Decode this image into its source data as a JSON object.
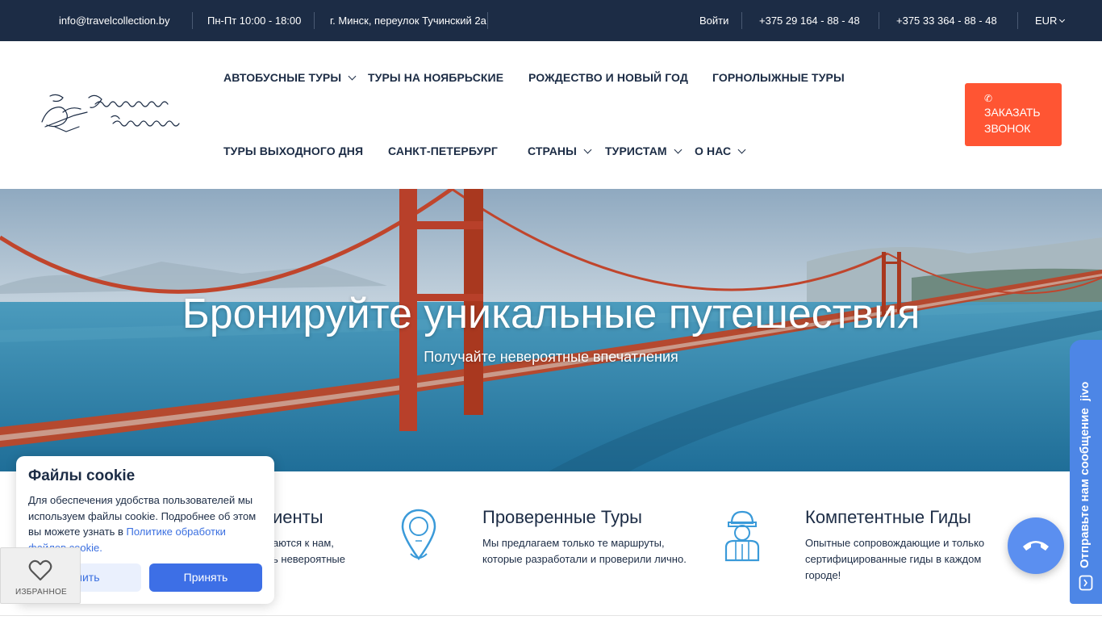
{
  "topbar": {
    "email": "info@travelcollection.by",
    "hours": "Пн-Пт 10:00 - 18:00",
    "address": "г. Минск, переулок Тучинский 2а",
    "login": "Войти",
    "phone1": "+375 29 164 - 88 - 48",
    "phone2": "+375 33 364 - 88 - 48",
    "currency": "EUR"
  },
  "nav": {
    "bus_tours": "АВТОБУСНЫЕ ТУРЫ",
    "november_tours": "ТУРЫ НА НОЯБРЬСКИЕ",
    "christmas": "РОЖДЕСТВО И НОВЫЙ ГОД",
    "ski_tours": "ГОРНОЛЫЖНЫЕ ТУРЫ",
    "weekend_tours": "ТУРЫ ВЫХОДНОГО ДНЯ",
    "spb": "САНКТ-ПЕТЕРБУРГ",
    "countries": "СТРАНЫ",
    "tourists": "ТУРИСТАМ",
    "about": "О НАС"
  },
  "callback": {
    "line1": "ЗАКАЗАТЬ",
    "line2": "ЗВОНОК"
  },
  "hero": {
    "title": "Бронируйте уникальные путешествия",
    "subtitle": "Получайте невероятные впечатления"
  },
  "features": [
    {
      "title": "иенты",
      "line1": "аются к нам,",
      "line2": "ь невероятные"
    },
    {
      "title": "Проверенные Туры",
      "line1": "Мы предлагаем только те маршруты,",
      "line2": "которые разработали и проверили лично."
    },
    {
      "title": "Компетентные Гиды",
      "line1": "Опытные сопровождающие и только",
      "line2": "сертифицированные гиды в каждом",
      "line3": "городе!"
    }
  ],
  "cookie": {
    "title": "Файлы cookie",
    "text": "Для обеспечения удобства пользователей мы используем файлы cookie. Подробнее об этом вы можете узнать в ",
    "link": "Политике обработки файлов cookie.",
    "decline": "онить",
    "accept": "Принять"
  },
  "favorites": {
    "label": "ИЗБРАННОЕ"
  },
  "jivo": {
    "label": "Отправьте нам сообщение",
    "brand": "jivo"
  },
  "colors": {
    "topbar_bg": "#1c2c45",
    "accent_orange": "#ff5533",
    "accent_blue": "#3d6fe6",
    "icon_blue": "#3a9ad9"
  },
  "icons": [
    "phone-icon",
    "chevron-down-icon",
    "map-pin-icon",
    "guide-icon",
    "heart-icon",
    "chat-icon",
    "call-icon"
  ]
}
